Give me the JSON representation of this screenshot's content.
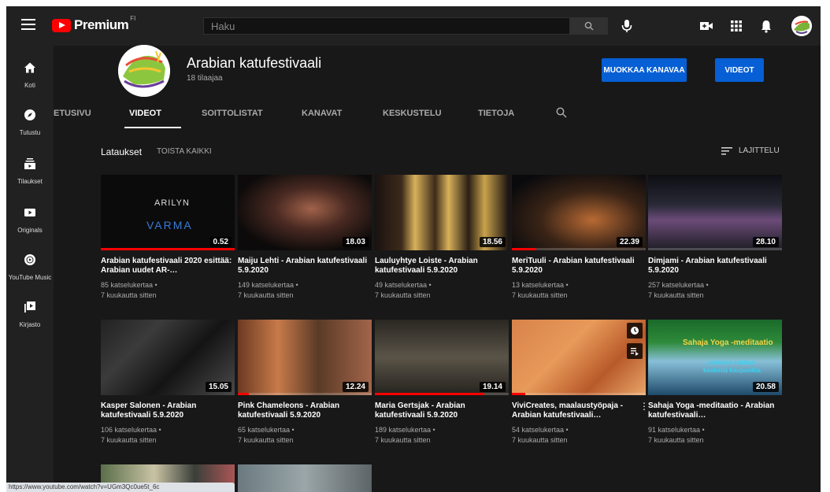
{
  "search": {
    "placeholder": "Haku"
  },
  "logo": {
    "text": "Premium",
    "country": "FI"
  },
  "sidebar": {
    "items": [
      {
        "label": "Koti",
        "icon": "home-icon"
      },
      {
        "label": "Tutustu",
        "icon": "compass-icon"
      },
      {
        "label": "Tilaukset",
        "icon": "subscriptions-icon"
      },
      {
        "label": "Originals",
        "icon": "originals-icon"
      },
      {
        "label": "YouTube Music",
        "icon": "music-icon"
      },
      {
        "label": "Kirjasto",
        "icon": "library-icon"
      }
    ]
  },
  "channel": {
    "name": "Arabian katufestivaali",
    "subscribers": "18 tilaajaa",
    "customize_label": "MUOKKAA KANAVAA",
    "videos_label": "VIDEOT"
  },
  "tabs": [
    "ETUSIVU",
    "VIDEOT",
    "SOITTOLISTAT",
    "KANAVAT",
    "KESKUSTELU",
    "TIETOJA"
  ],
  "section": {
    "title": "Lataukset",
    "play_all": "TOISTA KAIKKI",
    "sort": "LAJITTELU"
  },
  "videos": [
    {
      "title": "Arabian katufestivaali 2020 esittää: Arabian uudet AR-…",
      "views": "85 katselukertaa •",
      "age": "7 kuukautta sitten",
      "duration": "0.52",
      "progress": 1.0,
      "thumb_text": "ARILYN",
      "thumb_text2": "VARMA"
    },
    {
      "title": "Maiju Lehti - Arabian katufestivaali 5.9.2020",
      "views": "149 katselukertaa •",
      "age": "7 kuukautta sitten",
      "duration": "18.03",
      "progress": 0.0
    },
    {
      "title": "Lauluyhtye Loiste - Arabian katufestivaali 5.9.2020",
      "views": "49 katselukertaa •",
      "age": "7 kuukautta sitten",
      "duration": "18.56",
      "progress": 0.0
    },
    {
      "title": "MeriTuuli - Arabian katufestivaali 5.9.2020",
      "views": "13 katselukertaa •",
      "age": "7 kuukautta sitten",
      "duration": "22.39",
      "progress": 0.18
    },
    {
      "title": "Dimjami - Arabian katufestivaali 5.9.2020",
      "views": "257 katselukertaa •",
      "age": "7 kuukautta sitten",
      "duration": "28.10",
      "progress": 0.0
    },
    {
      "title": "Kasper Salonen - Arabian katufestivaali 5.9.2020",
      "views": "106 katselukertaa •",
      "age": "7 kuukautta sitten",
      "duration": "15.05",
      "progress": 0.0
    },
    {
      "title": "Pink Chameleons - Arabian katufestivaali 5.9.2020",
      "views": "65 katselukertaa •",
      "age": "7 kuukautta sitten",
      "duration": "12.24",
      "progress": 0.08
    },
    {
      "title": "Maria Gertsjak - Arabian katufestivaali 5.9.2020",
      "views": "189 katselukertaa •",
      "age": "7 kuukautta sitten",
      "duration": "19.14",
      "progress": 0.82
    },
    {
      "title": "ViviCreates, maalaustyöpaja - Arabian katufestivaali…",
      "views": "54 katselukertaa •",
      "age": "7 kuukautta sitten",
      "duration": "",
      "progress": 0.1
    },
    {
      "title": "Sahaja Yoga -meditaatio - Arabian katufestivaali…",
      "views": "91 katselukertaa •",
      "age": "7 kuukautta sitten",
      "duration": "20.58",
      "progress": 0.0,
      "thumb_text": "Sahaja Yoga -meditaatio",
      "thumb_text2": "...palanen rauhaa keskellä kaupunkia"
    }
  ],
  "status_url": "https://www.youtube.com/watch?v=UGm3Qc0ue5t_6c",
  "colors": {
    "accent_red": "#ff0000",
    "brand_blue": "#065fd4",
    "bg": "#181818",
    "bar": "#212121"
  }
}
